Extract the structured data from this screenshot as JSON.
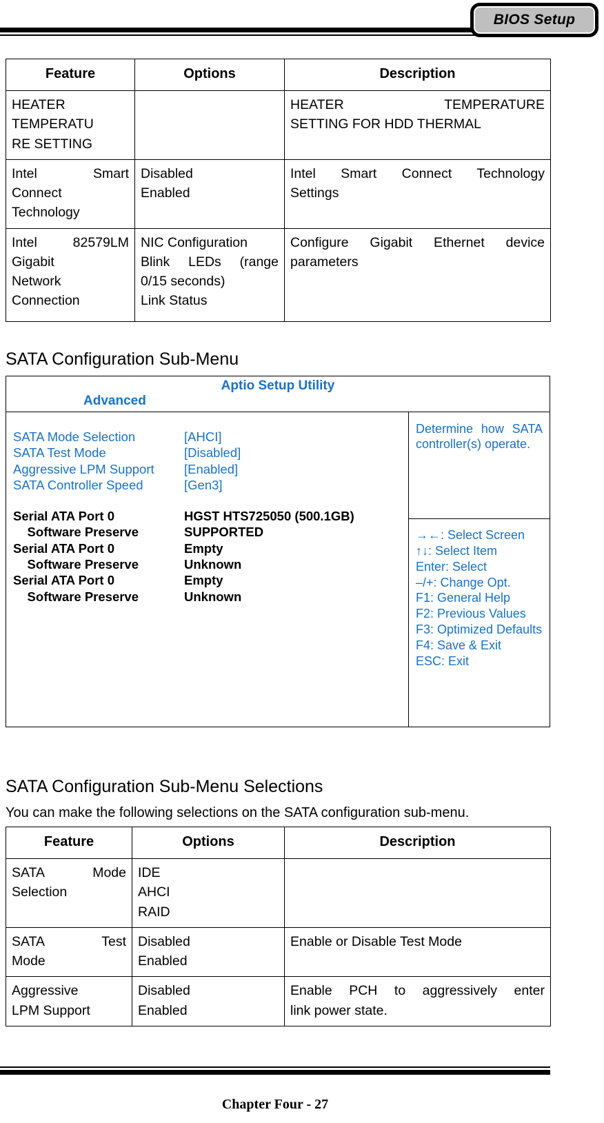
{
  "header": {
    "tab_label": "BIOS Setup"
  },
  "tables": {
    "advanced_menu": {
      "columns": [
        "Feature",
        "Options",
        "Description"
      ],
      "rows": [
        {
          "feature": "HEATER TEMPERATU RE SETTING",
          "options": [],
          "description": "HEATER TEMPERATURE SETTING FOR HDD THERMAL"
        },
        {
          "feature": "Intel Smart Connect Technology",
          "options": [
            "Disabled",
            "Enabled"
          ],
          "description": "Intel Smart Connect Technology Settings"
        },
        {
          "feature": "Intel 82579LM Gigabit Network Connection",
          "options": [
            "NIC Configuration",
            "Blink LEDs (range 0/15 seconds)",
            "Link Status"
          ],
          "description": "Configure Gigabit Ethernet device parameters"
        }
      ]
    },
    "sata_selections": {
      "columns": [
        "Feature",
        "Options",
        "Description"
      ],
      "rows": [
        {
          "feature": "SATA Mode Selection",
          "options": [
            "IDE",
            "AHCI",
            "RAID"
          ],
          "description": ""
        },
        {
          "feature": "SATA Test Mode",
          "options": [
            "Disabled",
            "Enabled"
          ],
          "description": "Enable or Disable Test Mode"
        },
        {
          "feature": "Aggressive LPM Support",
          "options": [
            "Disabled",
            "Enabled"
          ],
          "description": "Enable PCH to aggressively enter link power state."
        }
      ]
    }
  },
  "sections": {
    "sata_submenu_heading": "SATA Configuration Sub-Menu",
    "sata_selections_heading": "SATA Configuration Sub-Menu Selections",
    "sata_selections_intro": "You can make the following selections on the SATA configuration sub-menu."
  },
  "bios_screen": {
    "title": "Aptio Setup Utility",
    "menu_active": "Advanced",
    "accent_color": "#1a72c4",
    "settings": [
      {
        "label": "SATA Mode Selection",
        "value": "[AHCI]"
      },
      {
        "label": "SATA Test Mode",
        "value": "[Disabled]"
      },
      {
        "label": "Aggressive LPM Support",
        "value": "[Enabled]"
      },
      {
        "label": "SATA Controller Speed",
        "value": "[Gen3]"
      }
    ],
    "device_info": [
      {
        "label": "Serial ATA Port 0",
        "value": "HGST HTS725050 (500.1GB)"
      },
      {
        "label": "    Software Preserve",
        "value": "SUPPORTED"
      },
      {
        "label": "Serial ATA Port 0",
        "value": "Empty"
      },
      {
        "label": "    Software Preserve",
        "value": "Unknown"
      },
      {
        "label": "Serial ATA Port 0",
        "value": "Empty"
      },
      {
        "label": "    Software Preserve",
        "value": "Unknown"
      }
    ],
    "help_description": "Determine how SATA controller(s) operate.",
    "help_keys": [
      "→←: Select Screen",
      "↑↓: Select Item",
      "Enter: Select",
      "–/+: Change Opt.",
      "F1: General Help",
      "F2: Previous Values",
      "F3: Optimized Defaults",
      "F4: Save & Exit",
      "ESC: Exit"
    ]
  },
  "footer": {
    "page_label": "Chapter Four - 27"
  }
}
